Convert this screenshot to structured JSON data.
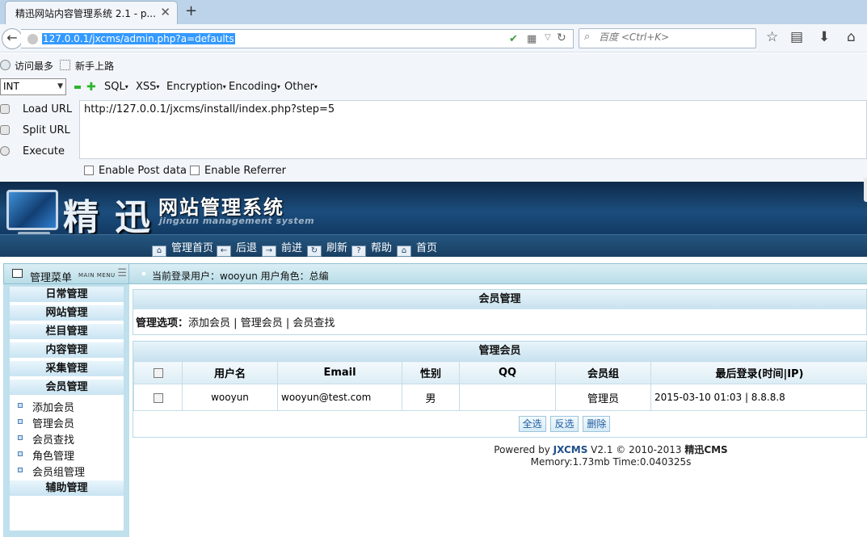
{
  "browser": {
    "tab_title": "精迅网站内容管理系统 2.1 - p...",
    "tab_close": "✕",
    "new_tab": "+",
    "url": "127.0.0.1/jxcms/admin.php?a=defaults",
    "search_placeholder": "百度 <Ctrl+K>",
    "bookmarks": [
      "访问最多",
      "新手上路"
    ],
    "icons": [
      "back-icon",
      "globe-icon",
      "shield-icon",
      "qr-icon",
      "reload-icon",
      "search-icon",
      "star-icon",
      "reader-icon",
      "download-icon",
      "home-icon"
    ]
  },
  "hackbar": {
    "type_select": "INT",
    "menus": [
      "SQL",
      "XSS",
      "Encryption",
      "Encoding",
      "Other"
    ],
    "buttons": [
      "Load URL",
      "Split URL",
      "Execute"
    ],
    "url_text": "http://127.0.0.1/jxcms/install/index.php?step=5",
    "checkboxes": [
      "Enable Post data",
      "Enable Referrer"
    ]
  },
  "cms": {
    "logo_big": "精迅",
    "logo_sys": "网站管理系统",
    "logo_en": "jingxun management system",
    "nav": [
      "管理首页",
      "后退",
      "前进",
      "刷新",
      "帮助",
      "首页"
    ],
    "menu_title": "管理菜单",
    "menu_title_en": "MAIN MENU",
    "menu_cats": [
      "日常管理",
      "网站管理",
      "栏目管理",
      "内容管理",
      "采集管理",
      "会员管理"
    ],
    "menu_subs": [
      "添加会员",
      "管理会员",
      "会员查找",
      "角色管理",
      "会员组管理"
    ],
    "menu_last": "辅助管理",
    "crumb": "当前登录用户：wooyun    用户角色：总编",
    "panel1_title": "会员管理",
    "options_label": "管理选项：",
    "options": [
      "添加会员",
      "管理会员",
      "会员查找"
    ],
    "options_sep": " | ",
    "panel2_title": "管理会员",
    "table_headers": [
      "用户名",
      "Email",
      "性别",
      "QQ",
      "会员组",
      "最后登录(时间|IP)"
    ],
    "table_rows": [
      {
        "username": "wooyun",
        "email": "wooyun@test.com",
        "gender": "男",
        "qq": "",
        "group": "管理员",
        "last_login": "2015-03-10 01:03 | 8.8.8.8"
      }
    ],
    "actions": [
      "全选",
      "反选",
      "删除"
    ],
    "footer_line1_pre": "Powered by ",
    "footer_brand": "JXCMS",
    "footer_line1_post": " V2.1  © 2010-2013 ",
    "footer_cn": "精迅CMS",
    "footer_line2": "Memory:1.73mb Time:0.040325s"
  }
}
